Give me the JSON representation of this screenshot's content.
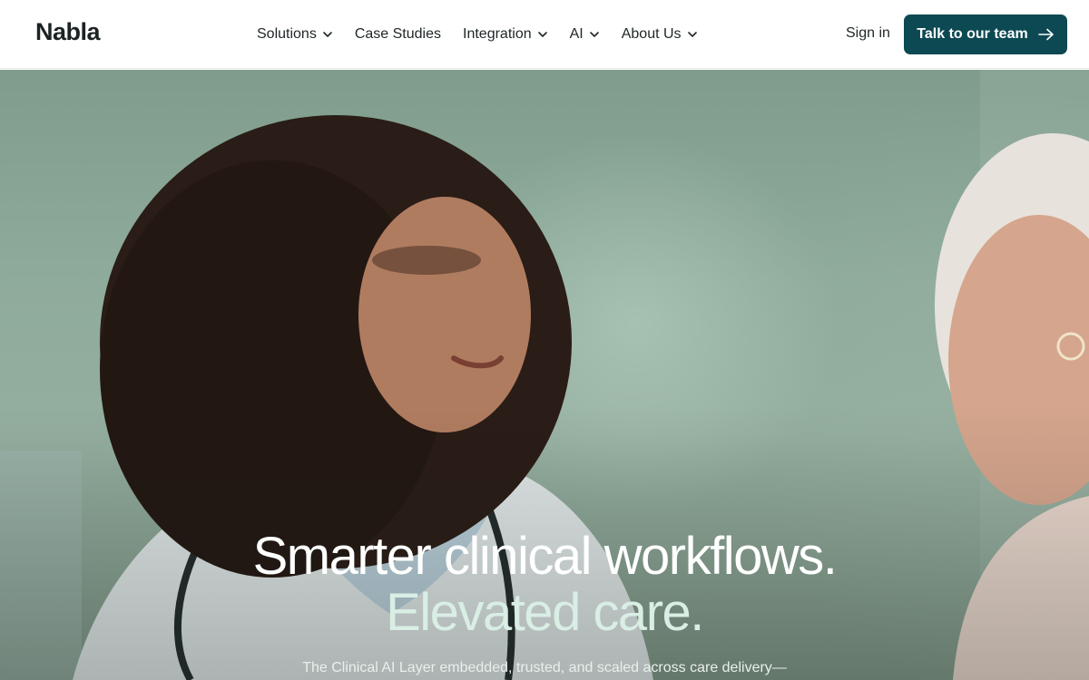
{
  "brand": {
    "name": "Nabla"
  },
  "nav": {
    "items": [
      {
        "label": "Solutions",
        "has_dropdown": true
      },
      {
        "label": "Case Studies",
        "has_dropdown": false
      },
      {
        "label": "Integration",
        "has_dropdown": true
      },
      {
        "label": "AI",
        "has_dropdown": true
      },
      {
        "label": "About Us",
        "has_dropdown": true
      }
    ],
    "sign_in": "Sign in",
    "cta": "Talk to our team"
  },
  "hero": {
    "headline_line1": "Smarter clinical workflows.",
    "headline_line2": "Elevated care.",
    "subheadline": "The Clinical AI Layer embedded, trusted, and scaled across care delivery—"
  },
  "colors": {
    "cta_background": "#0d4952",
    "text_dark": "#1f2627",
    "headline_accent": "#d9eee4"
  },
  "icons": {
    "dropdown": "chevron-down-icon",
    "cta": "arrow-right-icon"
  }
}
